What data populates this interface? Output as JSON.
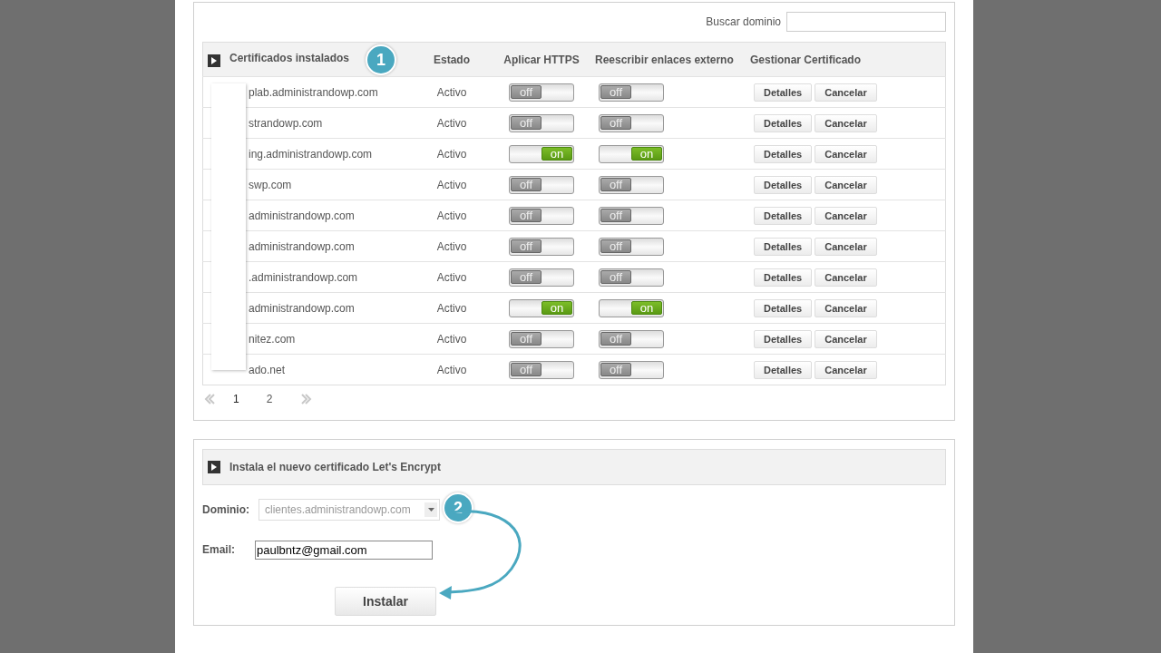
{
  "search": {
    "label": "Buscar dominio"
  },
  "table": {
    "columns": [
      "Certificados instalados",
      "Estado",
      "Aplicar HTTPS",
      "Reescribir enlaces externo",
      "Gestionar Certificado"
    ],
    "callout": "1",
    "rows": [
      {
        "domain": "plab.administrandowp.com",
        "status": "Activo",
        "https": {
          "on": false,
          "label": "off"
        },
        "rewrite": {
          "on": false,
          "label": "off"
        },
        "actions": [
          "Detalles",
          "Cancelar"
        ]
      },
      {
        "domain": "strandowp.com",
        "status": "Activo",
        "https": {
          "on": false,
          "label": "off"
        },
        "rewrite": {
          "on": false,
          "label": "off"
        },
        "actions": [
          "Detalles",
          "Cancelar"
        ]
      },
      {
        "domain": "ing.administrandowp.com",
        "status": "Activo",
        "https": {
          "on": true,
          "label": "on"
        },
        "rewrite": {
          "on": true,
          "label": "on"
        },
        "actions": [
          "Detalles",
          "Cancelar"
        ]
      },
      {
        "domain": "swp.com",
        "status": "Activo",
        "https": {
          "on": false,
          "label": "off"
        },
        "rewrite": {
          "on": false,
          "label": "off"
        },
        "actions": [
          "Detalles",
          "Cancelar"
        ]
      },
      {
        "domain": "administrandowp.com",
        "status": "Activo",
        "https": {
          "on": false,
          "label": "off"
        },
        "rewrite": {
          "on": false,
          "label": "off"
        },
        "actions": [
          "Detalles",
          "Cancelar"
        ]
      },
      {
        "domain": "administrandowp.com",
        "status": "Activo",
        "https": {
          "on": false,
          "label": "off"
        },
        "rewrite": {
          "on": false,
          "label": "off"
        },
        "actions": [
          "Detalles",
          "Cancelar"
        ]
      },
      {
        "domain": ".administrandowp.com",
        "status": "Activo",
        "https": {
          "on": false,
          "label": "off"
        },
        "rewrite": {
          "on": false,
          "label": "off"
        },
        "actions": [
          "Detalles",
          "Cancelar"
        ]
      },
      {
        "domain": "administrandowp.com",
        "status": "Activo",
        "https": {
          "on": true,
          "label": "on"
        },
        "rewrite": {
          "on": true,
          "label": "on"
        },
        "actions": [
          "Detalles",
          "Cancelar"
        ]
      },
      {
        "domain": "nitez.com",
        "status": "Activo",
        "https": {
          "on": false,
          "label": "off"
        },
        "rewrite": {
          "on": false,
          "label": "off"
        },
        "actions": [
          "Detalles",
          "Cancelar"
        ]
      },
      {
        "domain": "ado.net",
        "status": "Activo",
        "https": {
          "on": false,
          "label": "off"
        },
        "rewrite": {
          "on": false,
          "label": "off"
        },
        "actions": [
          "Detalles",
          "Cancelar"
        ]
      }
    ]
  },
  "pagination": {
    "pages": [
      {
        "label": "1",
        "selected": true
      },
      {
        "label": "2",
        "selected": false
      }
    ]
  },
  "install": {
    "title": "Instala el nuevo certificado Let's Encrypt",
    "domain_label": "Dominio:",
    "domain_value": "clientes.administrandowp.com",
    "email_label": "Email:",
    "email_value": "paulbntz@gmail.com",
    "button": "Instalar",
    "callout": "2"
  }
}
